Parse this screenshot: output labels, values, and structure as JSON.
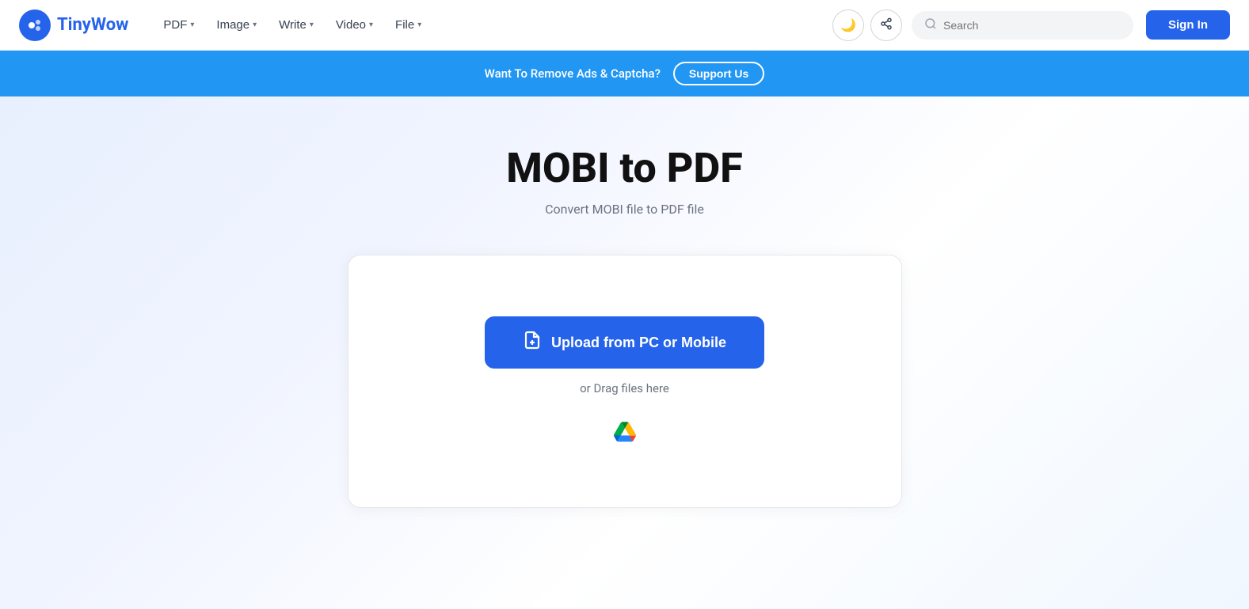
{
  "logo": {
    "name": "TinyWow",
    "name_prefix": "Tiny",
    "name_suffix": "Wow"
  },
  "nav": {
    "items": [
      {
        "label": "PDF",
        "has_chevron": true
      },
      {
        "label": "Image",
        "has_chevron": true
      },
      {
        "label": "Write",
        "has_chevron": true
      },
      {
        "label": "Video",
        "has_chevron": true
      },
      {
        "label": "File",
        "has_chevron": true
      }
    ]
  },
  "icons": {
    "dark_mode": "🌙",
    "share": "⤴"
  },
  "search": {
    "placeholder": "Search"
  },
  "signin": {
    "label": "Sign In"
  },
  "banner": {
    "text": "Want To Remove Ads & Captcha?",
    "button_label": "Support Us"
  },
  "main": {
    "title": "MOBI to PDF",
    "subtitle": "Convert MOBI file to PDF file",
    "upload_button": "Upload from PC or Mobile",
    "drag_text": "or Drag files here"
  }
}
